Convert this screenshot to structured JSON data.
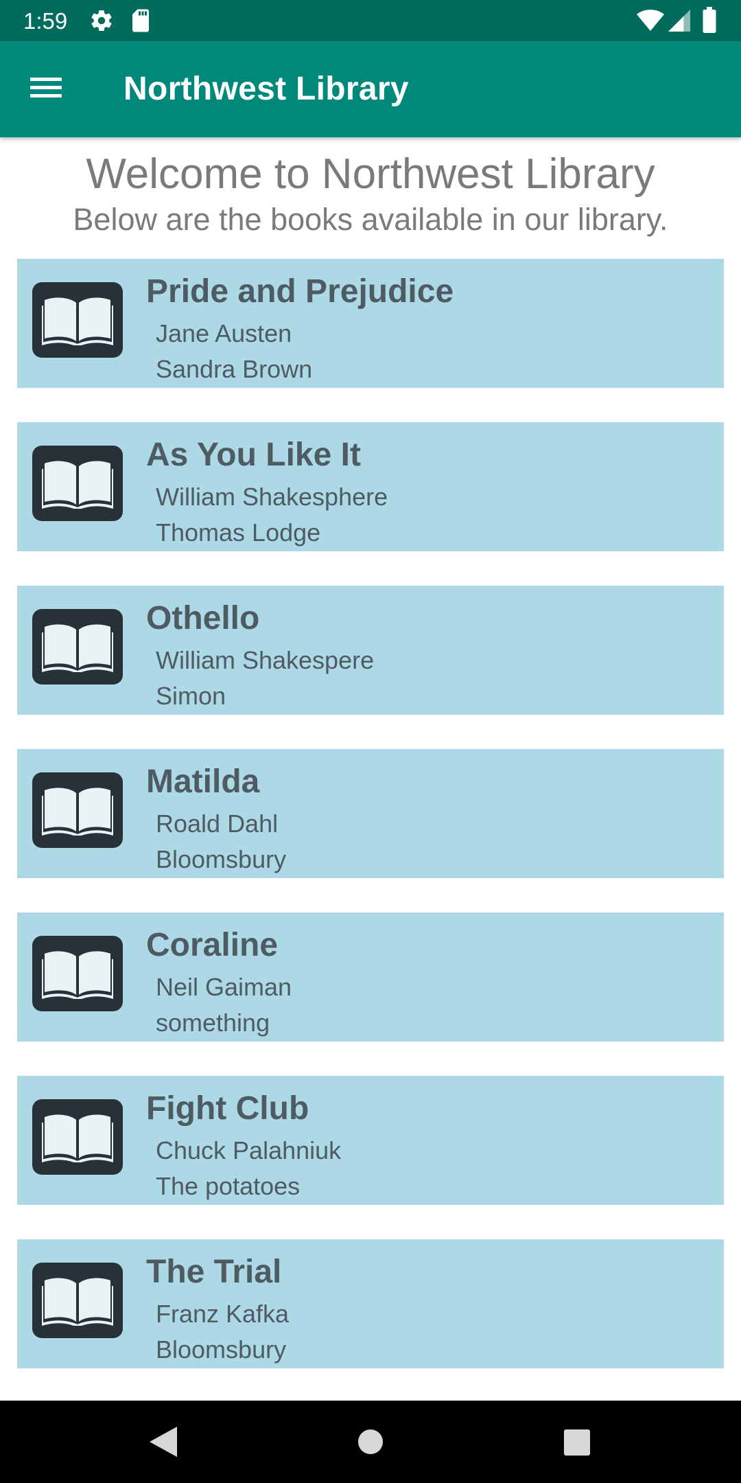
{
  "status_bar": {
    "time": "1:59",
    "icons": [
      "gear-icon",
      "sd-card-icon",
      "wifi-icon",
      "signal-icon",
      "battery-icon"
    ]
  },
  "app_bar": {
    "title": "Northwest Library",
    "menu_icon": "menu-icon",
    "color": "#00897b"
  },
  "header": {
    "title": "Welcome to Northwest Library",
    "subtitle": "Below are the books available in our library."
  },
  "books": [
    {
      "title": "Pride and Prejudice",
      "author": "Jane Austen",
      "publisher": "Sandra Brown"
    },
    {
      "title": "As You Like It",
      "author": "William Shakesphere",
      "publisher": "Thomas Lodge"
    },
    {
      "title": "Othello",
      "author": "William Shakespere",
      "publisher": "Simon"
    },
    {
      "title": "Matilda",
      "author": "Roald Dahl",
      "publisher": "Bloomsbury"
    },
    {
      "title": "Coraline",
      "author": "Neil Gaiman",
      "publisher": "something"
    },
    {
      "title": "Fight Club",
      "author": "Chuck Palahniuk",
      "publisher": "The potatoes"
    },
    {
      "title": "The Trial",
      "author": "Franz Kafka",
      "publisher": "Bloomsbury"
    }
  ],
  "colors": {
    "status_bar": "#016b5e",
    "card_background": "#add8e6",
    "card_text": "#4f5b62",
    "header_text": "#7a7a7a"
  },
  "nav_bar": {
    "buttons": [
      "back-icon",
      "home-icon",
      "recents-icon"
    ]
  }
}
